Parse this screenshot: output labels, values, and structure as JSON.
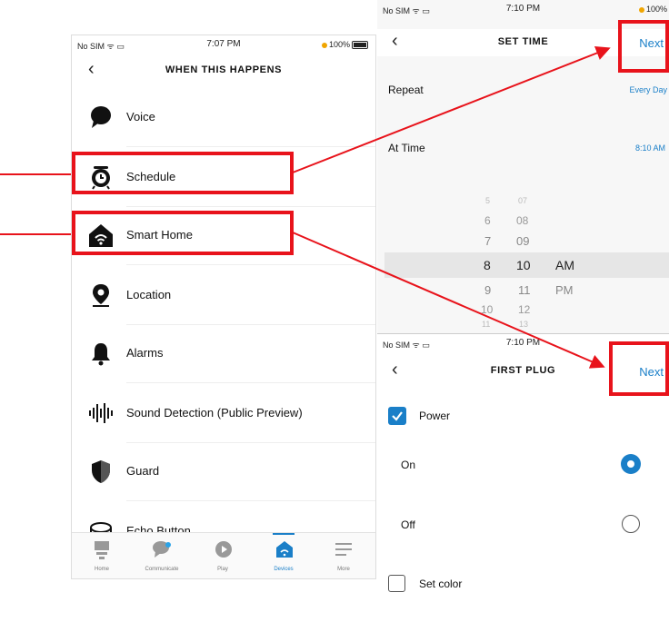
{
  "phone_left": {
    "status": {
      "carrier": "No SIM",
      "time": "7:07 PM",
      "battery": "100%"
    },
    "title": "WHEN THIS HAPPENS",
    "items": [
      {
        "label": "Voice",
        "icon": "speech-bubble-icon"
      },
      {
        "label": "Schedule",
        "icon": "alarm-clock-icon"
      },
      {
        "label": "Smart Home",
        "icon": "smart-home-icon"
      },
      {
        "label": "Location",
        "icon": "location-pin-icon"
      },
      {
        "label": "Alarms",
        "icon": "bell-icon"
      },
      {
        "label": "Sound Detection (Public Preview)",
        "icon": "sound-wave-icon"
      },
      {
        "label": "Guard",
        "icon": "shield-icon"
      },
      {
        "label": "Echo Button",
        "icon": "echo-button-icon"
      }
    ],
    "tabs": [
      {
        "label": "Home",
        "icon": "home-icon"
      },
      {
        "label": "Communicate",
        "icon": "chat-icon"
      },
      {
        "label": "Play",
        "icon": "play-icon"
      },
      {
        "label": "Devices",
        "icon": "devices-icon"
      },
      {
        "label": "More",
        "icon": "menu-icon"
      }
    ]
  },
  "phone_time": {
    "status": {
      "carrier": "No SIM",
      "time": "7:10 PM",
      "battery": "100%"
    },
    "title": "SET TIME",
    "next_label": "Next",
    "repeat_label": "Repeat",
    "repeat_value": "Every Day",
    "at_time_label": "At Time",
    "at_time_value": "8:10 AM",
    "picker": {
      "hours": [
        "5",
        "6",
        "7",
        "8",
        "9",
        "10",
        "11"
      ],
      "minutes": [
        "07",
        "08",
        "09",
        "10",
        "11",
        "12",
        "13"
      ],
      "ampm": [
        "AM",
        "PM"
      ]
    }
  },
  "phone_plug": {
    "status": {
      "carrier": "No SIM",
      "time": "7:10 PM"
    },
    "title": "FIRST PLUG",
    "next_label": "Next",
    "power_label": "Power",
    "power_checked": true,
    "on_label": "On",
    "off_label": "Off",
    "selected": "On",
    "set_color_label": "Set color",
    "set_color_checked": false
  },
  "colors": {
    "accent": "#1a7fc8",
    "highlight": "#e8131b"
  }
}
